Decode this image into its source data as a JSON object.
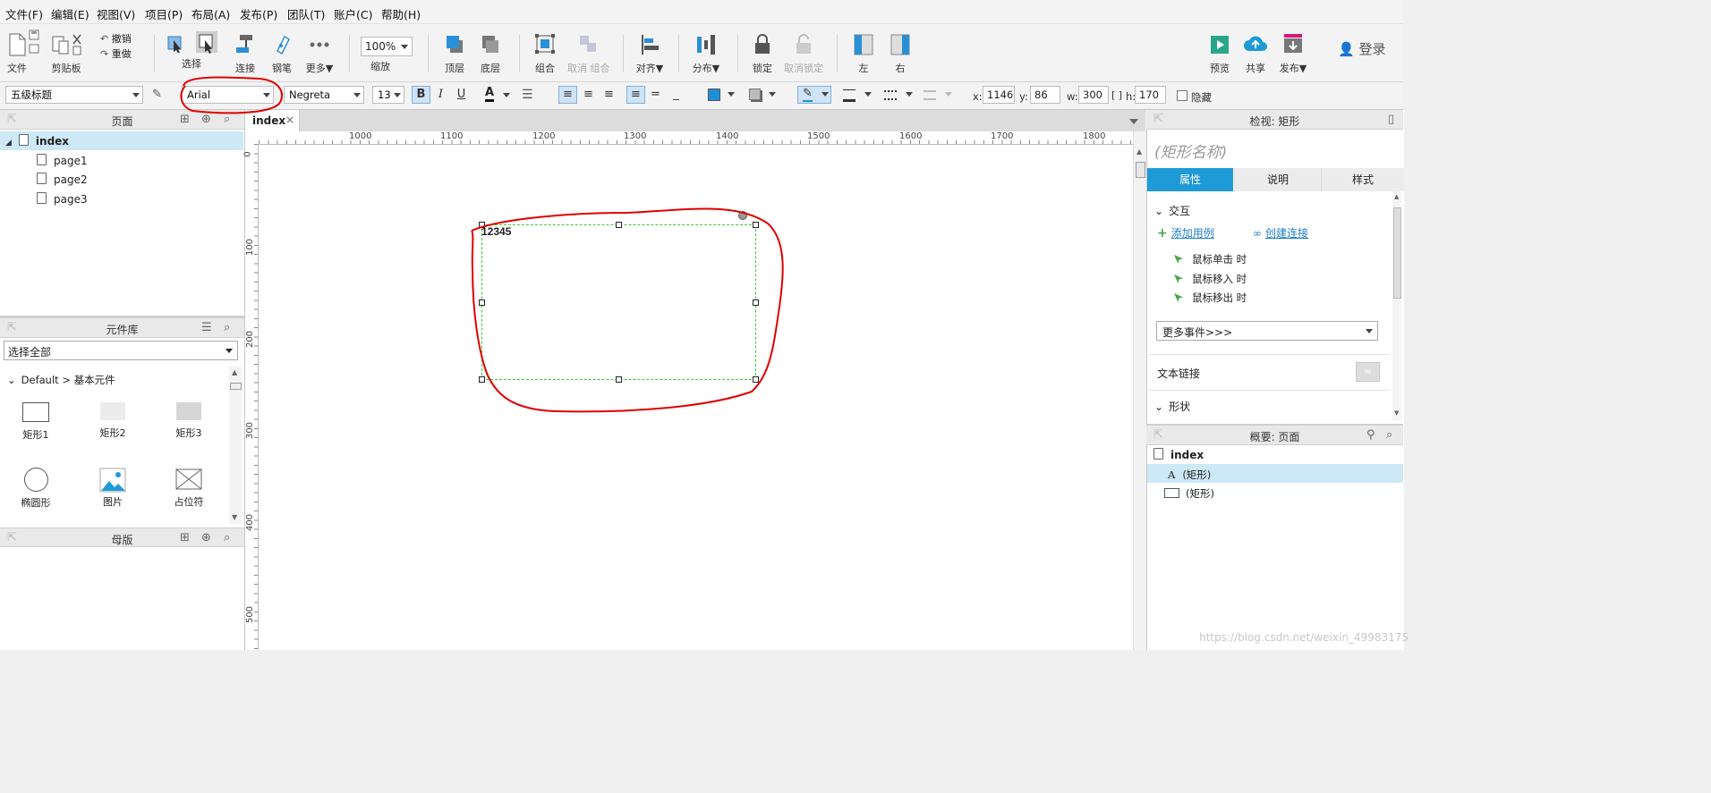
{
  "menu": [
    "文件(F)",
    "编辑(E)",
    "视图(V)",
    "项目(P)",
    "布局(A)",
    "发布(P)",
    "团队(T)",
    "账户(C)",
    "帮助(H)"
  ],
  "toolbar": {
    "file": "文件",
    "clipboard": "剪贴板",
    "undo": "撤销",
    "redo": "重做",
    "select": "选择",
    "connect": "连接",
    "pen": "钢笔",
    "more": "更多▼",
    "zoom_value": "100%",
    "zoom_label": "缩放",
    "top_layer": "顶层",
    "bottom_layer": "底层",
    "group": "组合",
    "ungroup": "取消 组合",
    "align": "对齐▼",
    "distribute": "分布▼",
    "lock": "锁定",
    "unlock": "取消锁定",
    "left": "左",
    "right": "右",
    "preview": "预览",
    "share": "共享",
    "publish": "发布▼",
    "login": "登录"
  },
  "format": {
    "style": "五级标题",
    "font": "Arial",
    "weight": "Negreta",
    "size": "13",
    "bold": "B",
    "italic": "I",
    "underline": "U",
    "font_color": "A",
    "x_label": "x:",
    "x": "1146",
    "y_label": "y:",
    "y": "86",
    "w_label": "w:",
    "w": "300",
    "h_label": "h:",
    "h": "170",
    "hidden": "隐藏"
  },
  "pages_panel": {
    "title": "页面",
    "root": "index",
    "children": [
      "page1",
      "page2",
      "page3"
    ]
  },
  "library_panel": {
    "title": "元件库",
    "filter": "选择全部",
    "path": "Default > 基本元件",
    "widgets": [
      "矩形1",
      "矩形2",
      "矩形3",
      "椭圆形",
      "图片",
      "占位符"
    ]
  },
  "masters_panel": {
    "title": "母版"
  },
  "tab": {
    "name": "index",
    "close": "×"
  },
  "ruler_h": [
    "1000",
    "1100",
    "1200",
    "1300",
    "1400",
    "1500",
    "1600",
    "1700",
    "1800"
  ],
  "ruler_v": [
    "0",
    "100",
    "200",
    "300",
    "400",
    "500"
  ],
  "shape_text": "12345",
  "inspector": {
    "title": "检视: 矩形",
    "name_placeholder": "(矩形名称)",
    "tabs": [
      "属性",
      "说明",
      "样式"
    ],
    "interaction": "交互",
    "add_case": "添加用例",
    "create_link": "创建连接",
    "events": [
      "鼠标单击 时",
      "鼠标移入 时",
      "鼠标移出 时"
    ],
    "more_events": "更多事件>>>",
    "text_link": "文本链接",
    "shape": "形状"
  },
  "outline": {
    "title": "概要: 页面",
    "root": "index",
    "items": [
      "(矩形)",
      "(矩形)"
    ]
  },
  "watermark": "https://blog.csdn.net/weixin_49983175",
  "colors": {
    "accent": "#1e9ad6",
    "annotation": "#e00000",
    "selection": "#33cc33"
  }
}
